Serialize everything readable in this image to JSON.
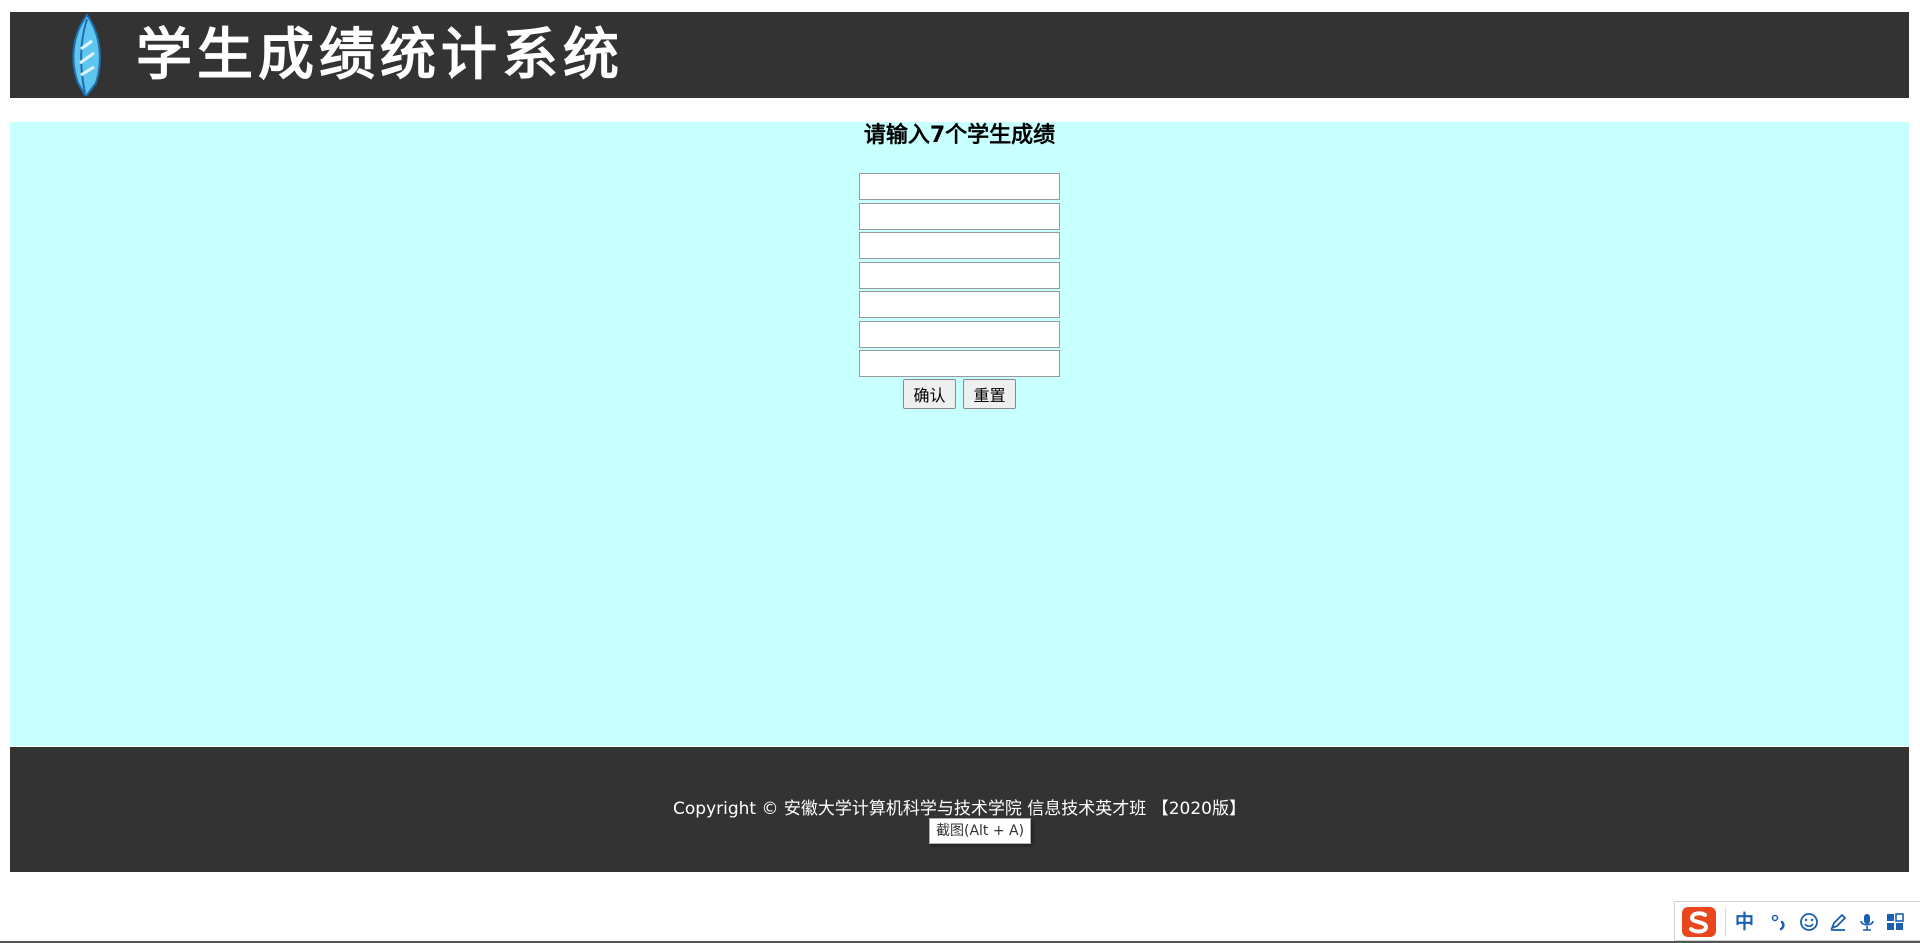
{
  "header": {
    "site_title": "学生成绩统计系统"
  },
  "form": {
    "heading": "请输入7个学生成绩",
    "inputs": [
      "",
      "",
      "",
      "",
      "",
      "",
      ""
    ],
    "confirm_label": "确认",
    "reset_label": "重置"
  },
  "footer": {
    "copyright": "Copyright © 安徽大学计算机科学与技术学院 信息技术英才班 【2020版】"
  },
  "tooltip": {
    "text": "截图(Alt + A)"
  },
  "ime": {
    "mode_label": "中"
  },
  "colors": {
    "header_bg": "#333333",
    "main_bg": "#c8ffff",
    "footer_bg": "#333333",
    "ime_blue": "#1a5fb4",
    "ime_logo": "#e8461d"
  },
  "icons": {
    "logo": "feather-icon",
    "ime_logo": "sogou-s-icon",
    "ime_punct": "punctuation-icon",
    "ime_emoji": "emoji-icon",
    "ime_brush": "brush-icon",
    "ime_voice": "microphone-icon",
    "ime_tools": "toolbox-icon"
  }
}
